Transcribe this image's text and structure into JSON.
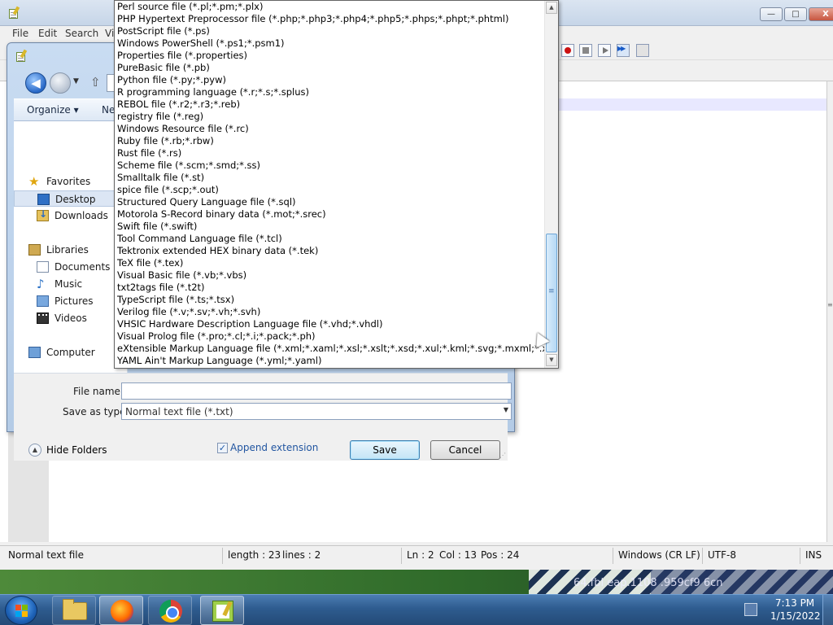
{
  "npp": {
    "menu": [
      "File",
      "Edit",
      "Search",
      "Vi"
    ],
    "statusbar": {
      "filetype": "Normal text file",
      "length": "length : 23",
      "lines": "lines : 2",
      "ln": "Ln : 2",
      "col": "Col : 13",
      "pos": "Pos : 24",
      "eol": "Windows (CR LF)",
      "encoding": "UTF-8",
      "mode": "INS"
    },
    "window_buttons": {
      "minimize": "—",
      "maximize": "□",
      "close": "X"
    }
  },
  "dialog": {
    "back_arrow": "◀",
    "toolbar": {
      "organize": "Organize ▾",
      "new_folder": "Ne"
    },
    "nav": {
      "favorites": "Favorites",
      "desktop": "Desktop",
      "downloads": "Downloads",
      "libraries": "Libraries",
      "documents": "Documents",
      "music": "Music",
      "pictures": "Pictures",
      "videos": "Videos",
      "computer": "Computer"
    },
    "file_name_label": "File name:",
    "save_as_type_label": "Save as type:",
    "save_as_type_value": "Normal text file (*.txt)",
    "hide_folders": "Hide Folders",
    "append_extension": "Append extension",
    "append_checked": "✓",
    "save": "Save",
    "cancel": "Cancel"
  },
  "dropdown": {
    "items": [
      "Perl source file (*.pl;*.pm;*.plx)",
      "PHP Hypertext Preprocessor file (*.php;*.php3;*.php4;*.php5;*.phps;*.phpt;*.phtml)",
      "PostScript file (*.ps)",
      "Windows PowerShell (*.ps1;*.psm1)",
      "Properties file (*.properties)",
      "PureBasic file (*.pb)",
      "Python file (*.py;*.pyw)",
      "R programming language (*.r;*.s;*.splus)",
      "REBOL file (*.r2;*.r3;*.reb)",
      "registry file (*.reg)",
      "Windows Resource file (*.rc)",
      "Ruby file (*.rb;*.rbw)",
      "Rust file (*.rs)",
      "Scheme file (*.scm;*.smd;*.ss)",
      "Smalltalk file (*.st)",
      "spice file (*.scp;*.out)",
      "Structured Query Language file (*.sql)",
      "Motorola S-Record binary data (*.mot;*.srec)",
      "Swift file (*.swift)",
      "Tool Command Language file (*.tcl)",
      "Tektronix extended HEX binary data (*.tek)",
      "TeX file (*.tex)",
      "Visual Basic file (*.vb;*.vbs)",
      "txt2tags file (*.t2t)",
      "TypeScript file (*.ts;*.tsx)",
      "Verilog file (*.v;*.sv;*.vh;*.svh)",
      "VHSIC Hardware Description Language file (*.vhd;*.vhdl)",
      "Visual Prolog file (*.pro;*.cl;*.i;*.pack;*.ph)",
      "eXtensible Markup Language file (*.xml;*.xaml;*.xsl;*.xslt;*.xsd;*.xul;*.kml;*.svg;*.mxml;*.xsml; *.*.*)",
      "YAML Ain't Markup Language (*.yml;*.yaml)"
    ],
    "scroll_up": "▲",
    "scroll_down": "▼"
  },
  "desktop": {
    "wallpaper_text": "64.fbl eap.1108 .959cf9 6cn"
  },
  "taskbar": {
    "clock_time": "7:13 PM",
    "clock_date": "1/15/2022"
  }
}
